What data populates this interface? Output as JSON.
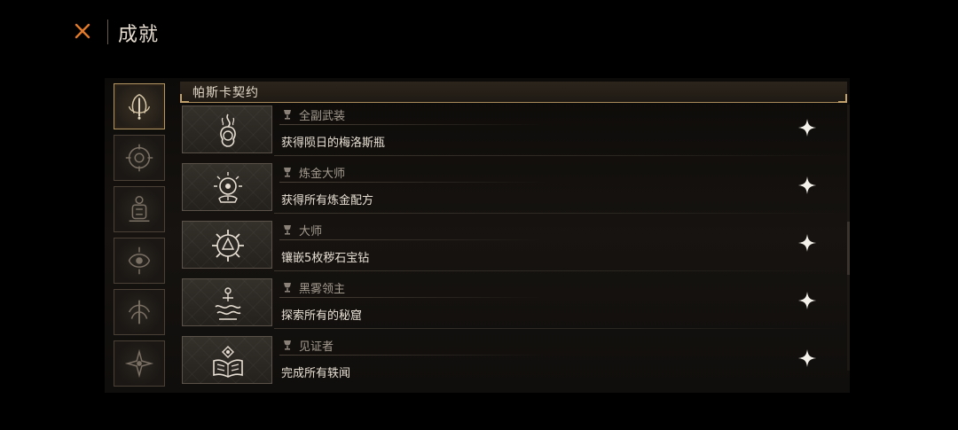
{
  "header": {
    "title": "成就",
    "close_icon": "close-x-icon"
  },
  "categories": [
    {
      "icon": "pascal-sigil-icon",
      "active": true
    },
    {
      "icon": "compass-sigil-icon",
      "active": false
    },
    {
      "icon": "totem-sigil-icon",
      "active": false
    },
    {
      "icon": "eye-sigil-icon",
      "active": false
    },
    {
      "icon": "tree-sigil-icon",
      "active": false
    },
    {
      "icon": "star-sigil-icon",
      "active": false
    }
  ],
  "section": {
    "title": "帕斯卡契约"
  },
  "achievements": [
    {
      "name": "全副武装",
      "description": "获得陨日的梅洛斯瓶",
      "icon": "flame-emblem-icon"
    },
    {
      "name": "炼金大师",
      "description": "获得所有炼金配方",
      "icon": "alchemy-emblem-icon"
    },
    {
      "name": "大师",
      "description": "镶嵌5枚秽石宝钻",
      "icon": "gear-emblem-icon"
    },
    {
      "name": "黑雾领主",
      "description": "探索所有的秘窟",
      "icon": "fog-emblem-icon"
    },
    {
      "name": "见证者",
      "description": "完成所有轶闻",
      "icon": "book-emblem-icon"
    }
  ],
  "colors": {
    "accent_gold": "#b59763",
    "close_orange": "#e07a2a",
    "text_light": "#e8e0d4",
    "text_muted": "#a59c90"
  }
}
